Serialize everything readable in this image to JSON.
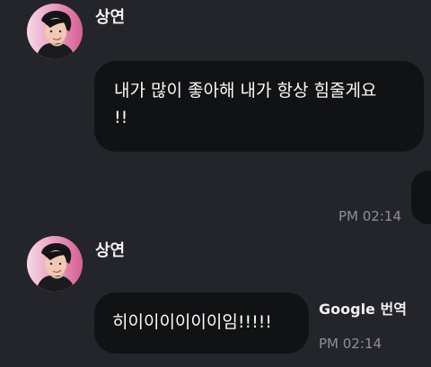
{
  "messages": [
    {
      "sender": "상연",
      "text_line1": "내가 많이 좋아해 내가 항상 힘줄게요",
      "text_line2": "!!",
      "time": "PM 02:14"
    },
    {
      "sender": "상연",
      "text": "히이이이이이이임!!!!!",
      "translate_label": "Google 번역",
      "time": "PM 02:14"
    }
  ],
  "theme": {
    "background": "#24252a",
    "bubble": "#111214",
    "text": "#fbfbfb",
    "time": "#8f9096",
    "avatar_ring": "#d36494"
  }
}
